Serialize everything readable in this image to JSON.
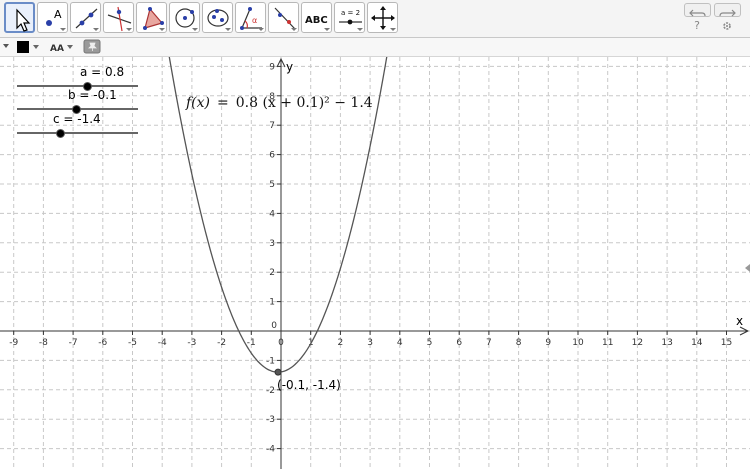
{
  "toolbar": {
    "tools": [
      {
        "name": "move-tool-button",
        "icon": "cursor-arrow-icon",
        "active": true
      },
      {
        "name": "point-tool-button",
        "icon": "point-icon",
        "label": "A"
      },
      {
        "name": "line-tool-button",
        "icon": "line-through-points-icon"
      },
      {
        "name": "perpendicular-line-tool-button",
        "icon": "perpendicular-line-icon"
      },
      {
        "name": "polygon-tool-button",
        "icon": "polygon-icon"
      },
      {
        "name": "circle-tool-button",
        "icon": "circle-center-point-icon"
      },
      {
        "name": "conic-tool-button",
        "icon": "conic-icon"
      },
      {
        "name": "angle-tool-button",
        "icon": "angle-icon",
        "label": "α"
      },
      {
        "name": "reflect-tool-button",
        "icon": "reflect-about-line-icon"
      },
      {
        "name": "text-tool-button",
        "icon": "text-icon",
        "label": "ABC"
      },
      {
        "name": "slider-tool-button",
        "icon": "slider-icon",
        "label": "a = 2"
      },
      {
        "name": "move-graphics-view-tool-button",
        "icon": "move-view-icon"
      }
    ],
    "undo_icon": "undo-icon",
    "redo_icon": "redo-icon",
    "help": "?",
    "settings_icon": "gear-icon"
  },
  "stylebar": {
    "color_swatch": "#000000",
    "font_label": "AA",
    "pin_icon": "pin-icon"
  },
  "sliders": [
    {
      "name": "a",
      "label": "a = 0.8",
      "value": 0.8,
      "min": -5,
      "max": 5
    },
    {
      "name": "b",
      "label": "b = -0.1",
      "value": -0.1,
      "min": -5,
      "max": 5
    },
    {
      "name": "c",
      "label": "c = -1.4",
      "value": -1.4,
      "min": -5,
      "max": 5
    }
  ],
  "function_label": {
    "lhs": "f(x)",
    "eq": "=",
    "rhs": "0.8 (x + 0.1)² − 1.4"
  },
  "chart_data": {
    "type": "line",
    "function": {
      "a": 0.8,
      "h": -0.1,
      "k": -1.4
    },
    "xlim": [
      -9.3,
      15.8
    ],
    "ylim": [
      -4.3,
      9.3
    ],
    "x_ticks": [
      -9,
      -8,
      -7,
      -6,
      -5,
      -4,
      -3,
      -2,
      -1,
      0,
      1,
      2,
      3,
      4,
      5,
      6,
      7,
      8,
      9,
      10,
      11,
      12,
      13,
      14,
      15
    ],
    "y_ticks": [
      -4,
      -3,
      -2,
      -1,
      0,
      1,
      2,
      3,
      4,
      5,
      6,
      7,
      8,
      9
    ],
    "xlabel": "x",
    "ylabel": "y",
    "grid": true,
    "vertex": {
      "x": -0.1,
      "y": -1.4,
      "label": "(-0.1, -1.4)"
    }
  }
}
